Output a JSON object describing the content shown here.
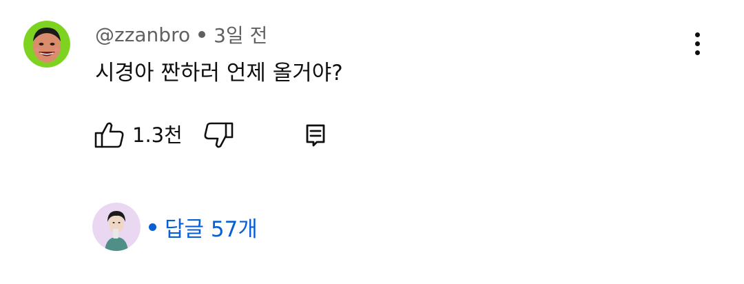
{
  "comment": {
    "handle": "@zzanbro",
    "time": "3일 전",
    "text": "시경아 짠하러 언제 올거야?",
    "like_count": "1.3천"
  },
  "replies": {
    "label": "답글 57개"
  },
  "icons": {
    "more": "more-vertical-icon",
    "like": "thumbs-up-icon",
    "dislike": "thumbs-down-icon",
    "reply": "comment-icon"
  },
  "colors": {
    "secondary_text": "#606060",
    "link_blue": "#065fd4",
    "avatar_green": "#7ed321"
  }
}
